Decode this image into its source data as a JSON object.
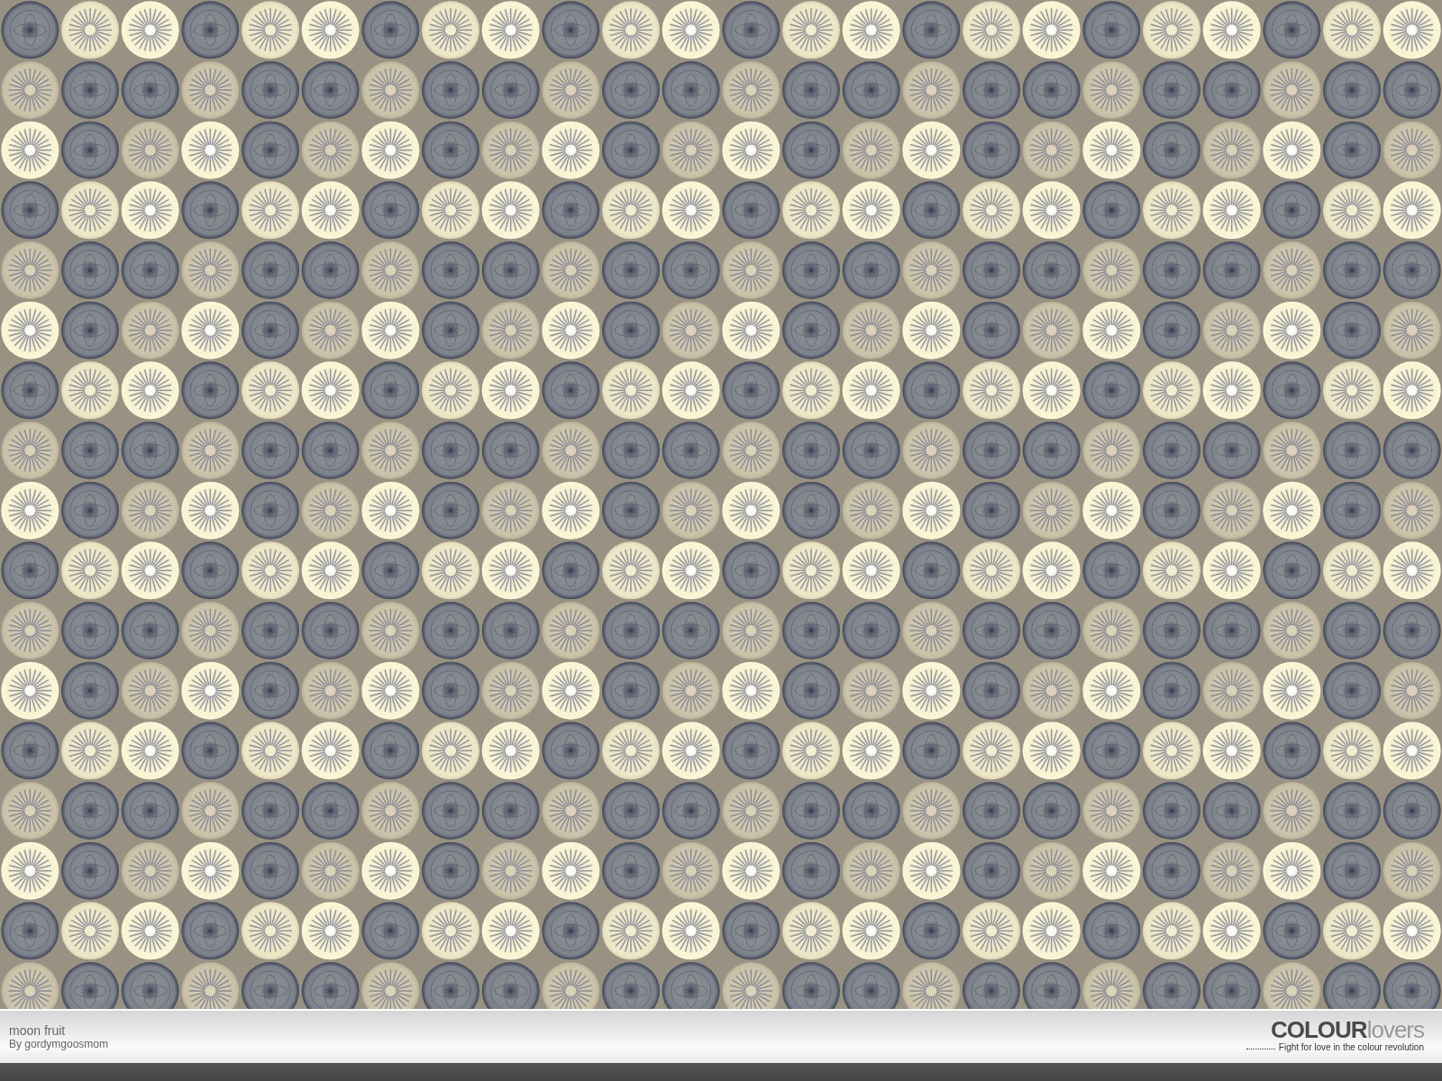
{
  "pattern": {
    "title": "moon fruit",
    "author": "By gordymgoosmom"
  },
  "brand": {
    "logo_strong": "COLOUR",
    "logo_light": "lovers",
    "tagline": "Fight for love in the colour revolution"
  }
}
